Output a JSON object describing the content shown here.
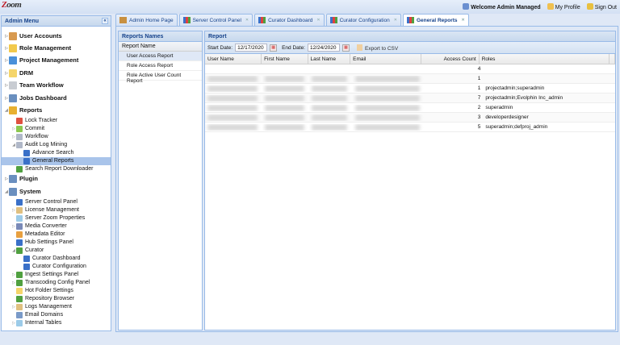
{
  "header": {
    "logo": "Zoom",
    "welcome": "Welcome Admin Managed",
    "my_profile": "My Profile",
    "sign_out": "Sign Out"
  },
  "sidebar": {
    "title": "Admin Menu",
    "collapse": "«",
    "items": [
      {
        "label": "User Accounts",
        "level": 0,
        "top": true,
        "arrow": "▷",
        "color": "#d89a50"
      },
      {
        "label": "Role Management",
        "level": 0,
        "top": true,
        "arrow": "▷",
        "color": "#f2c94c"
      },
      {
        "label": "Project Management",
        "level": 0,
        "top": true,
        "arrow": "▷",
        "color": "#4a90d9"
      },
      {
        "label": "DRM",
        "level": 0,
        "top": true,
        "arrow": "▷",
        "color": "#f5d56a"
      },
      {
        "label": "Team Workflow",
        "level": 0,
        "top": true,
        "arrow": "▷",
        "color": "#c8ccd2"
      },
      {
        "label": "Jobs Dashboard",
        "level": 0,
        "top": true,
        "arrow": "▷",
        "color": "#6a8fbf"
      },
      {
        "label": "Reports",
        "level": 0,
        "top": true,
        "arrow": "◢",
        "color": "#e8b030"
      },
      {
        "label": "Lock Tracker",
        "level": 1,
        "arrow": "",
        "color": "#e05040"
      },
      {
        "label": "Commit",
        "level": 1,
        "arrow": "▷",
        "color": "#8cc850"
      },
      {
        "label": "Workflow",
        "level": 1,
        "arrow": "▷",
        "color": "#b0b8c8"
      },
      {
        "label": "Audit Log Mining",
        "level": 1,
        "arrow": "◢",
        "color": "#b0b8c8"
      },
      {
        "label": "Advance Search",
        "level": 2,
        "arrow": "",
        "color": "#3a70c8"
      },
      {
        "label": "General Reports",
        "level": 2,
        "arrow": "",
        "color": "#3a70c8",
        "selected": true
      },
      {
        "label": "Search Report Downloader",
        "level": 1,
        "arrow": "",
        "color": "#50a040"
      },
      {
        "label": "Plugin",
        "level": 0,
        "top": true,
        "arrow": "▷",
        "color": "#6a8fbf"
      },
      {
        "label": "System",
        "level": 0,
        "top": true,
        "arrow": "◢",
        "color": "#6a8fbf"
      },
      {
        "label": "Server Control Panel",
        "level": 1,
        "arrow": "",
        "color": "#3a70c8"
      },
      {
        "label": "License Management",
        "level": 1,
        "arrow": "▷",
        "color": "#e0c080"
      },
      {
        "label": "Server Zoom Properties",
        "level": 1,
        "arrow": "",
        "color": "#9ccbe8"
      },
      {
        "label": "Media Converter",
        "level": 1,
        "arrow": "▷",
        "color": "#7a8ab8"
      },
      {
        "label": "Metadata Editor",
        "level": 1,
        "arrow": "",
        "color": "#e8a040"
      },
      {
        "label": "Hub Settings Panel",
        "level": 1,
        "arrow": "",
        "color": "#3a70c8"
      },
      {
        "label": "Curator",
        "level": 1,
        "arrow": "◢",
        "color": "#50a040"
      },
      {
        "label": "Curator Dashboard",
        "level": 2,
        "arrow": "",
        "color": "#3a70c8"
      },
      {
        "label": "Curator Configuration",
        "level": 2,
        "arrow": "",
        "color": "#3a70c8"
      },
      {
        "label": "Ingest Settings Panel",
        "level": 1,
        "arrow": "▷",
        "color": "#50a040"
      },
      {
        "label": "Transcoding Config Panel",
        "level": 1,
        "arrow": "▷",
        "color": "#50a040"
      },
      {
        "label": "Hot Folder Settings",
        "level": 1,
        "arrow": "",
        "color": "#f5d56a"
      },
      {
        "label": "Repository Browser",
        "level": 1,
        "arrow": "",
        "color": "#50a040"
      },
      {
        "label": "Logs Management",
        "level": 1,
        "arrow": "▷",
        "color": "#e0c080"
      },
      {
        "label": "Email Domains",
        "level": 1,
        "arrow": "",
        "color": "#7a9ac8"
      },
      {
        "label": "Internal Tables",
        "level": 1,
        "arrow": "▷",
        "color": "#9ccbe8"
      }
    ]
  },
  "tabs": [
    {
      "label": "Admin Home Page",
      "closable": false,
      "color": "#c89040"
    },
    {
      "label": "Server Control Panel",
      "closable": true,
      "color": "#3a70c8"
    },
    {
      "label": "Curator Dashboard",
      "closable": true,
      "color": "#3a70c8"
    },
    {
      "label": "Curator Configuration",
      "closable": true,
      "color": "#3a70c8"
    },
    {
      "label": "General Reports",
      "closable": true,
      "active": true,
      "color": "#3a70c8"
    }
  ],
  "reports_names": {
    "title": "Reports Names",
    "column": "Report Name",
    "items": [
      "User Access Report",
      "Role Access Report",
      "Role Active User Count Report"
    ],
    "selected": 0
  },
  "report": {
    "title": "Report",
    "start_label": "Start Date:",
    "start_value": "12/17/2020",
    "end_label": "End Date:",
    "end_value": "12/24/2020",
    "export": "Export to CSV",
    "columns": [
      "User Name",
      "First Name",
      "Last Name",
      "Email",
      "Access Count",
      "Roles"
    ],
    "rows": [
      {
        "count": "4",
        "roles": ""
      },
      {
        "count": "1",
        "roles": ""
      },
      {
        "count": "1",
        "roles": "projectadmin;superadmin"
      },
      {
        "count": "7",
        "roles": "projectadmin;Evolphin Inc_admin"
      },
      {
        "count": "2",
        "roles": "superadmin"
      },
      {
        "count": "3",
        "roles": "developerdesigner"
      },
      {
        "count": "5",
        "roles": "superadmin;defproj_admin"
      }
    ]
  }
}
